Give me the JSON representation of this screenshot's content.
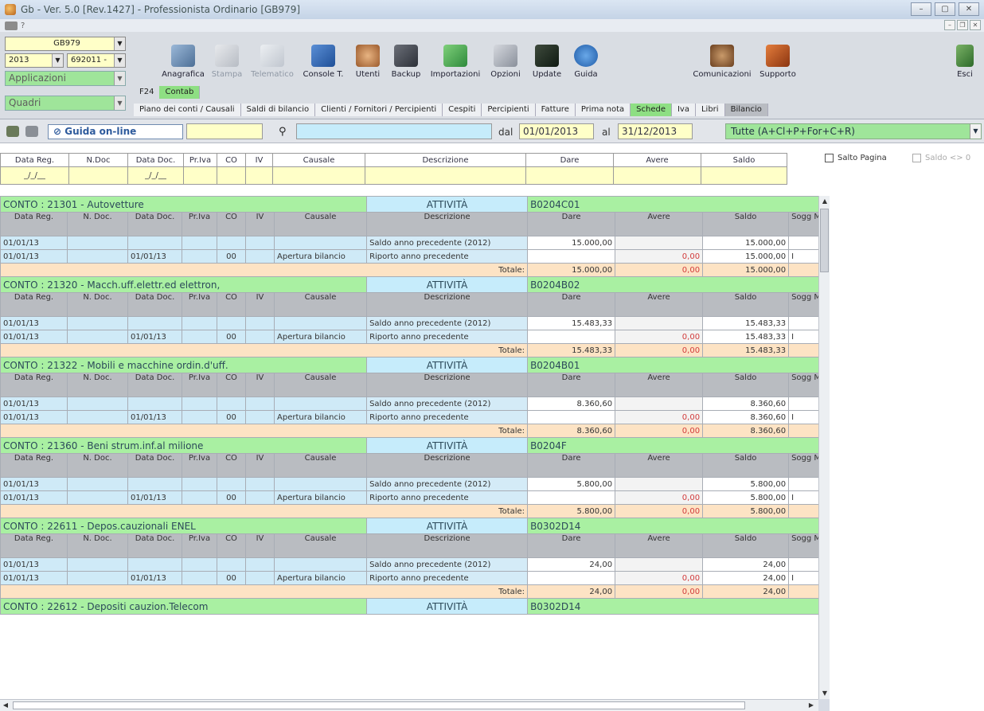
{
  "window": {
    "title": "Gb - Ver. 5.0 [Rev.1427] - Professionista Ordinario [GB979]",
    "menu_help": "?",
    "min": "–",
    "max": "▢",
    "close": "✕"
  },
  "selectors": {
    "company_code": "GB979",
    "year": "2013",
    "account_code": "692011 -",
    "applicazioni": "Applicazioni",
    "quadri": "Quadri"
  },
  "toolbar": {
    "anagrafica": "Anagrafica",
    "stampa": "Stampa",
    "telematico": "Telematico",
    "console": "Console T.",
    "utenti": "Utenti",
    "backup": "Backup",
    "importazioni": "Importazioni",
    "opzioni": "Opzioni",
    "update": "Update",
    "guida": "Guida",
    "comunicazioni": "Comunicazioni",
    "supporto": "Supporto",
    "esci": "Esci"
  },
  "app_tabs": {
    "f24": "F24",
    "contabilita": "Contab"
  },
  "sub_tabs": [
    "Piano dei conti / Causali",
    "Saldi di bilancio",
    "Clienti / Fornitori / Percipienti",
    "Cespiti",
    "Percipienti",
    "Fatture",
    "Prima nota",
    "Schede",
    "Iva",
    "Libri",
    "Bilancio"
  ],
  "search": {
    "guida_online": "Guida on-line",
    "dal_label": "dal",
    "date_from": "01/01/2013",
    "al_label": "al",
    "date_to": "31/12/2013",
    "filter": "Tutte (A+Cl+P+For+C+R)"
  },
  "filter_header": {
    "columns": [
      "Data Reg.",
      "N.Doc",
      "Data Doc.",
      "Pr.Iva",
      "CO",
      "IV",
      "Causale",
      "Descrizione",
      "Dare",
      "Avere",
      "Saldo"
    ],
    "date_placeholder": "_/_/__",
    "salto_pagina": "Salto Pagina",
    "saldo_diff": "Saldo <> 0"
  },
  "grid": {
    "columns": [
      "Data Reg.",
      "N. Doc.",
      "Data Doc.",
      "Pr.Iva",
      "CO",
      "IV",
      "Causale",
      "Descrizione",
      "Dare",
      "Avere",
      "Saldo",
      "Sogg Milc"
    ],
    "conto_prefix": "CONTO :",
    "totale_label": "Totale:",
    "accounts": [
      {
        "name": "21301 - Autovetture",
        "type": "ATTIVITÀ",
        "code": "B0204C01",
        "rows": [
          {
            "data_reg": "01/01/13",
            "n_doc": "",
            "data_doc": "",
            "co": "",
            "causale": "",
            "descrizione": "Saldo anno precedente (2012)",
            "dare": "15.000,00",
            "avere": "",
            "saldo": "15.000,00",
            "sogg": ""
          },
          {
            "data_reg": "01/01/13",
            "n_doc": "",
            "data_doc": "01/01/13",
            "co": "00",
            "causale": "Apertura bilancio",
            "descrizione": "Riporto anno precedente",
            "dare": "",
            "avere": "0,00",
            "saldo": "15.000,00",
            "sogg": "I"
          }
        ],
        "tot_dare": "15.000,00",
        "tot_avere": "0,00",
        "tot_saldo": "15.000,00"
      },
      {
        "name": "21320 - Macch.uff.elettr.ed elettron,",
        "type": "ATTIVITÀ",
        "code": "B0204B02",
        "rows": [
          {
            "data_reg": "01/01/13",
            "n_doc": "",
            "data_doc": "",
            "co": "",
            "causale": "",
            "descrizione": "Saldo anno precedente (2012)",
            "dare": "15.483,33",
            "avere": "",
            "saldo": "15.483,33",
            "sogg": ""
          },
          {
            "data_reg": "01/01/13",
            "n_doc": "",
            "data_doc": "01/01/13",
            "co": "00",
            "causale": "Apertura bilancio",
            "descrizione": "Riporto anno precedente",
            "dare": "",
            "avere": "0,00",
            "saldo": "15.483,33",
            "sogg": "I"
          }
        ],
        "tot_dare": "15.483,33",
        "tot_avere": "0,00",
        "tot_saldo": "15.483,33"
      },
      {
        "name": "21322 - Mobili e macchine ordin.d'uff.",
        "type": "ATTIVITÀ",
        "code": "B0204B01",
        "rows": [
          {
            "data_reg": "01/01/13",
            "n_doc": "",
            "data_doc": "",
            "co": "",
            "causale": "",
            "descrizione": "Saldo anno precedente (2012)",
            "dare": "8.360,60",
            "avere": "",
            "saldo": "8.360,60",
            "sogg": ""
          },
          {
            "data_reg": "01/01/13",
            "n_doc": "",
            "data_doc": "01/01/13",
            "co": "00",
            "causale": "Apertura bilancio",
            "descrizione": "Riporto anno precedente",
            "dare": "",
            "avere": "0,00",
            "saldo": "8.360,60",
            "sogg": "I"
          }
        ],
        "tot_dare": "8.360,60",
        "tot_avere": "0,00",
        "tot_saldo": "8.360,60"
      },
      {
        "name": "21360 - Beni strum.inf.al milione",
        "type": "ATTIVITÀ",
        "code": "B0204F",
        "rows": [
          {
            "data_reg": "01/01/13",
            "n_doc": "",
            "data_doc": "",
            "co": "",
            "causale": "",
            "descrizione": "Saldo anno precedente (2012)",
            "dare": "5.800,00",
            "avere": "",
            "saldo": "5.800,00",
            "sogg": ""
          },
          {
            "data_reg": "01/01/13",
            "n_doc": "",
            "data_doc": "01/01/13",
            "co": "00",
            "causale": "Apertura bilancio",
            "descrizione": "Riporto anno precedente",
            "dare": "",
            "avere": "0,00",
            "saldo": "5.800,00",
            "sogg": "I"
          }
        ],
        "tot_dare": "5.800,00",
        "tot_avere": "0,00",
        "tot_saldo": "5.800,00"
      },
      {
        "name": "22611 - Depos.cauzionali ENEL",
        "type": "ATTIVITÀ",
        "code": "B0302D14",
        "rows": [
          {
            "data_reg": "01/01/13",
            "n_doc": "",
            "data_doc": "",
            "co": "",
            "causale": "",
            "descrizione": "Saldo anno precedente (2012)",
            "dare": "24,00",
            "avere": "",
            "saldo": "24,00",
            "sogg": ""
          },
          {
            "data_reg": "01/01/13",
            "n_doc": "",
            "data_doc": "01/01/13",
            "co": "00",
            "causale": "Apertura bilancio",
            "descrizione": "Riporto anno precedente",
            "dare": "",
            "avere": "0,00",
            "saldo": "24,00",
            "sogg": "I"
          }
        ],
        "tot_dare": "24,00",
        "tot_avere": "0,00",
        "tot_saldo": "24,00"
      }
    ],
    "last_account": {
      "name": "22612 - Depositi cauzion.Telecom",
      "type": "ATTIVITÀ",
      "code": "B0302D14"
    }
  }
}
